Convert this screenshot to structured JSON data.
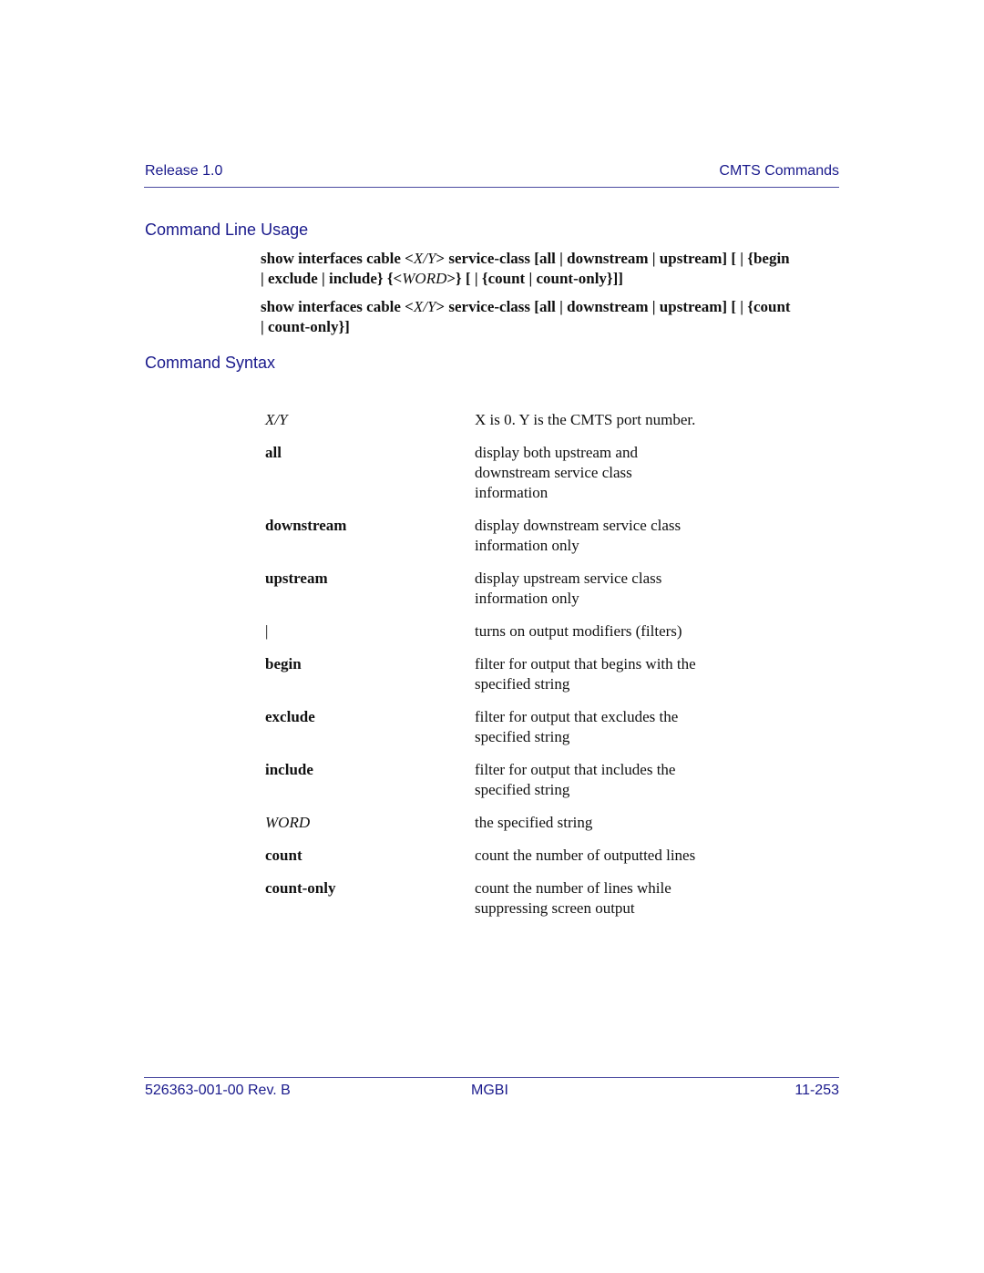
{
  "header": {
    "left": "Release 1.0",
    "right": "CMTS Commands"
  },
  "sections": {
    "usage_title": "Command Line Usage",
    "syntax_title": "Command Syntax"
  },
  "usage": [
    {
      "parts": [
        {
          "t": "show interfaces cable <",
          "s": "b"
        },
        {
          "t": "X/Y",
          "s": "i"
        },
        {
          "t": "> service-class [all | downstream | upstream] [ | {begin | exclude | include} {<",
          "s": "b"
        },
        {
          "t": "WORD",
          "s": "i"
        },
        {
          "t": ">} [ | {count | count-only}]]",
          "s": "b"
        }
      ]
    },
    {
      "parts": [
        {
          "t": "show interfaces cable <",
          "s": "b"
        },
        {
          "t": "X/Y",
          "s": "i"
        },
        {
          "t": "> service-class [all | downstream | upstream] [ | {count | count-only}]",
          "s": "b"
        }
      ]
    }
  ],
  "usage_text": {
    "u1_p1": "show interfaces cable ",
    "u1_lt1": "<",
    "u1_xy": "X/Y",
    "u1_gt1": ">",
    "u1_p2": " service-class [all | downstream | upstream] [ | {begin",
    "u1_p3": " | exclude | include} ",
    "u1_lt2": "{<",
    "u1_word": "WORD",
    "u1_gt2": ">}",
    "u1_p4": " [ | {count | count-only}]]",
    "u2_p1": "show interfaces cable ",
    "u2_lt1": "<",
    "u2_xy": "X/Y",
    "u2_gt1": ">",
    "u2_p2": " service-class [all | downstream | upstream] [ | {count",
    "u2_p3": " | count-only}]"
  },
  "syntax": [
    {
      "term": "X/Y",
      "style": "italic",
      "desc": "X is 0. Y is the CMTS port number."
    },
    {
      "term": "all",
      "style": "bold",
      "desc": "display both upstream and\ndownstream service class\ninformation"
    },
    {
      "term": "downstream",
      "style": "bold",
      "desc": "display downstream service class\ninformation only"
    },
    {
      "term": "upstream",
      "style": "bold",
      "desc": "display upstream service class\ninformation only"
    },
    {
      "term": "|",
      "style": "normal",
      "desc": "turns on output modifiers (filters)"
    },
    {
      "term": "begin",
      "style": "bold",
      "desc": "filter for output that begins with the\nspecified string"
    },
    {
      "term": "exclude",
      "style": "bold",
      "desc": "filter for output that excludes the\nspecified string"
    },
    {
      "term": "include",
      "style": "bold",
      "desc": "filter for output that includes the\nspecified string"
    },
    {
      "term": "WORD",
      "style": "italic",
      "desc": "the specified string"
    },
    {
      "term": "count",
      "style": "bold",
      "desc": "count the number of outputted lines"
    },
    {
      "term": "count-only",
      "style": "bold",
      "desc": "count the number of lines while\nsuppressing screen output"
    }
  ],
  "footer": {
    "left": "526363-001-00 Rev. B",
    "center": "MGBI",
    "right": "11-253"
  },
  "colors": {
    "heading": "#1a1a8c",
    "rule": "#4a4aa0",
    "body_text": "#111111"
  }
}
